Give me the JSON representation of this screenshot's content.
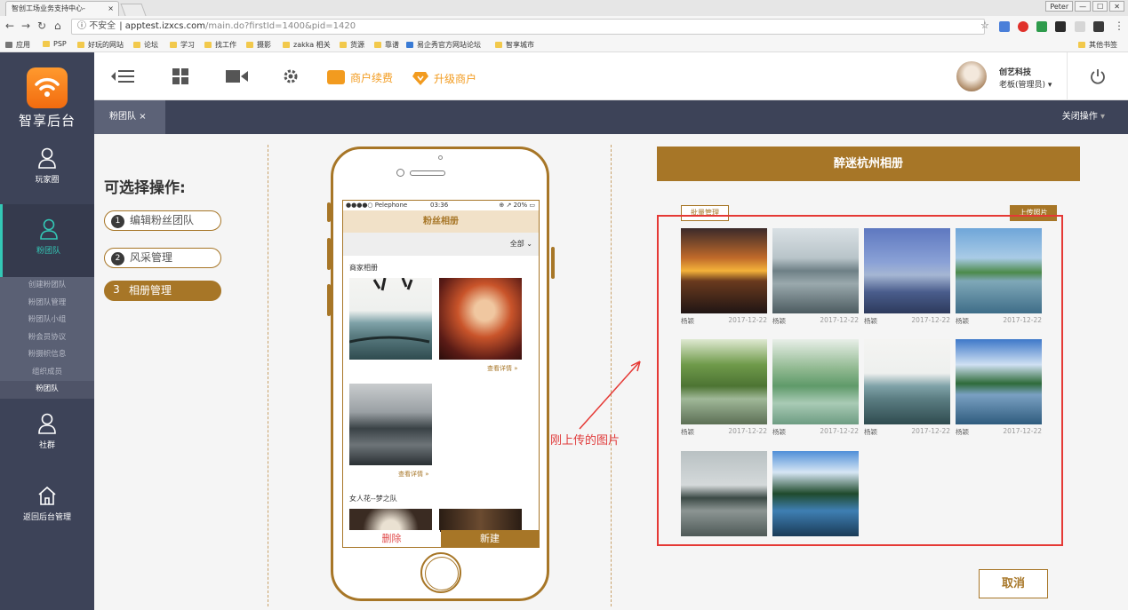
{
  "browser": {
    "tab_title": "智创工场业务支持中心-",
    "tab_close": "×",
    "url_prefix": "不安全",
    "url_host": "apptest.izxcs.com",
    "url_path": "/main.do?firstId=1400&pid=1420",
    "win_label": "Peter",
    "win_buttons": [
      "—",
      "☐",
      "✕"
    ],
    "bookmarks": [
      "应用",
      "PSP",
      "好玩的网站",
      "论坛",
      "学习",
      "找工作",
      "摄影",
      "zakka 相关",
      "货源",
      "靠谱",
      "易企秀官方网站论坛",
      "智享城市"
    ],
    "other_bookmarks": "其他书签"
  },
  "sidebar": {
    "brand": "智享后台",
    "items": [
      {
        "label": "玩家圈"
      },
      {
        "label": "粉团队"
      },
      {
        "label": "社群"
      },
      {
        "label": "返回后台管理"
      }
    ],
    "submenu": [
      "创建粉团队",
      "粉团队管理",
      "粉团队小组",
      "粉会员协议",
      "粉摄帜信息",
      "组织成员",
      "粉团队"
    ]
  },
  "topbar": {
    "renew_label": "商户续费",
    "upgrade_label": "升级商户",
    "user_name": "创艺科技",
    "user_role": "老板(管理员)"
  },
  "tabrow": {
    "tab_label": "粉团队",
    "tab_close": "×",
    "close_ops": "关闭操作"
  },
  "ops": {
    "title": "可选择操作:",
    "buttons": [
      {
        "num": "1",
        "label": "编辑粉丝团队"
      },
      {
        "num": "2",
        "label": "风采管理"
      },
      {
        "num": "3",
        "label": "相册管理"
      }
    ]
  },
  "phone": {
    "carrier": "●●●●○ Pelephone",
    "time": "03:36",
    "battery": "20%",
    "title": "粉丝相册",
    "filter": "全部",
    "section1": "商家相册",
    "more": "查看详情 »",
    "section2": "女人花--梦之队",
    "delete": "删除",
    "new": "新建"
  },
  "annotation": "刚上传的图片",
  "album": {
    "title": "醉迷杭州相册",
    "batch": "批量管理",
    "upload": "上传照片",
    "cancel": "取消",
    "photos": [
      {
        "author": "杨颖",
        "date": "2017-12-22"
      },
      {
        "author": "杨颖",
        "date": "2017-12-22"
      },
      {
        "author": "杨颖",
        "date": "2017-12-22"
      },
      {
        "author": "杨颖",
        "date": "2017-12-22"
      },
      {
        "author": "杨颖",
        "date": "2017-12-22"
      },
      {
        "author": "杨颖",
        "date": "2017-12-22"
      },
      {
        "author": "杨颖",
        "date": "2017-12-22"
      },
      {
        "author": "杨颖",
        "date": "2017-12-22"
      },
      {
        "author": "",
        "date": ""
      },
      {
        "author": "",
        "date": ""
      }
    ]
  }
}
